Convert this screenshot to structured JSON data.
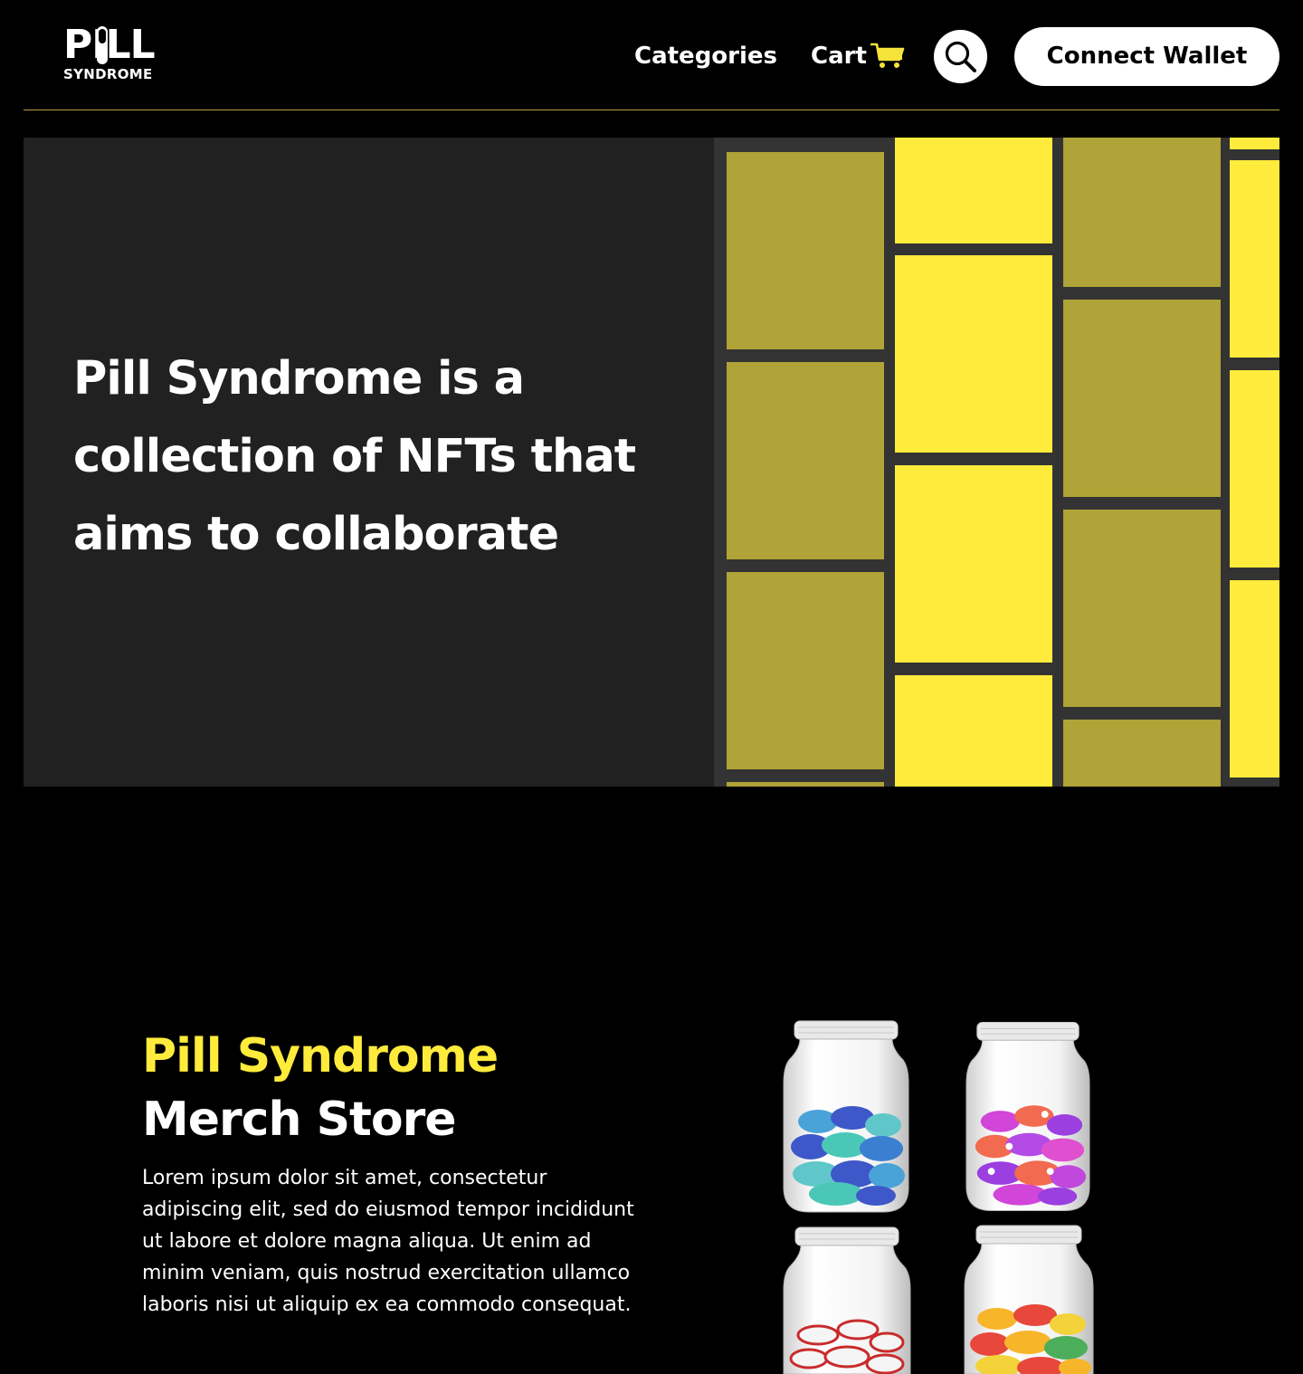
{
  "header": {
    "logo_top": "PILL",
    "logo_bottom": "SYNDROME",
    "nav": {
      "categories": "Categories",
      "cart": "Cart"
    },
    "icons": {
      "cart": "cart-icon",
      "search": "search-icon"
    },
    "connect_wallet": "Connect Wallet"
  },
  "hero": {
    "title": "Pill Syndrome is a collection of NFTs that aims to collaborate"
  },
  "merch": {
    "title_accent": "Pill Syndrome",
    "title_rest": "Merch Store",
    "description": "Lorem ipsum dolor sit amet, consectetur adipiscing elit, sed do eiusmod tempor incididunt ut labore et dolore magna aliqua. Ut enim ad minim veniam, quis nostrud exercitation ullamco laboris nisi ut aliquip ex ea commodo consequat."
  },
  "colors": {
    "accent_yellow": "#ffeb3b",
    "olive": "#b0a337",
    "hero_bg": "#212121",
    "page_bg": "#000000"
  }
}
